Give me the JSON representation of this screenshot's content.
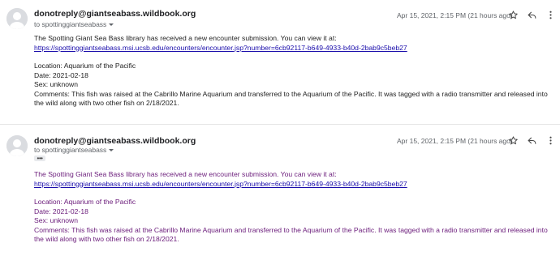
{
  "messages": [
    {
      "sender": "donotreply@giantseabass.wildbook.org",
      "to_line": "to spottinggiantseabass",
      "timestamp": "Apr 15, 2021, 2:15 PM (21 hours ago)",
      "intro": "The Spotting Giant Sea Bass library has received a new encounter submission. You can view it at:",
      "link": "https://spottinggiantseabass.msi.ucsb.edu/encounters/encounter.jsp?number=6cb92117-b649-4933-b40d-2bab9c5beb27",
      "location": "Location:  Aquarium of the Pacific",
      "date": "Date:  2021-02-18",
      "sex": "Sex:  unknown",
      "comments": "Comments:  This fish was raised at the Cabrillo Marine Aquarium and transferred to the Aquarium of the Pacific. It was tagged with a radio transmitter and released into the wild along with two other fish on 2/18/2021."
    },
    {
      "sender": "donotreply@giantseabass.wildbook.org",
      "to_line": "to spottinggiantseabass",
      "timestamp": "Apr 15, 2021, 2:15 PM (21 hours ago)",
      "show_trimmed": "•••",
      "intro": "The Spotting Giant Sea Bass library has received a new encounter submission. You can view it at:",
      "link": "https://spottinggiantseabass.msi.ucsb.edu/encounters/encounter.jsp?number=6cb92117-b649-4933-b40d-2bab9c5beb27",
      "location": "Location:  Aquarium of the Pacific",
      "date": "Date:  2021-02-18",
      "sex": "Sex:  unknown",
      "comments": "Comments:  This fish was raised at the Cabrillo Marine Aquarium and transferred to the Aquarium of the Pacific. It was tagged with a radio transmitter and released into the wild along with two other fish on 2/18/2021."
    }
  ],
  "icons": {
    "avatar": "person-icon",
    "star": "star-outline-icon",
    "reply": "reply-icon",
    "more": "more-vertical-icon"
  },
  "colors": {
    "quoted_text": "#6a1b7a",
    "link": "#1a0dab",
    "meta_text": "#5f6368"
  }
}
